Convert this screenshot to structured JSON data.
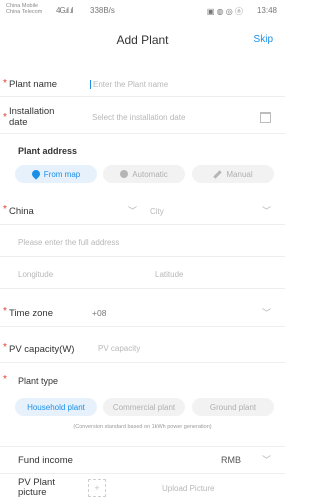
{
  "status_bar": {
    "carrier_line1": "China Mobile",
    "carrier_line2": "China Telecom",
    "signal": "4G",
    "speed": "338B/s",
    "icons": "▣ ◍ ◎ ⓝ",
    "time": "13:48"
  },
  "header": {
    "title": "Add Plant",
    "skip_label": "Skip"
  },
  "form": {
    "plant_name": {
      "label": "Plant name",
      "placeholder": "Enter the Plant name"
    },
    "installation_date": {
      "label": "Installation date",
      "placeholder": "Select the installation date"
    },
    "plant_address": {
      "label": "Plant address",
      "modes": [
        "From map",
        "Automatic",
        "Manual"
      ]
    },
    "country": {
      "label": "China",
      "region_placeholder": "City"
    },
    "full_address_placeholder": "Please enter the full address",
    "longitude_placeholder": "Longitude",
    "latitude_placeholder": "Latitude",
    "time_zone": {
      "label": "Time zone",
      "value": "+08"
    },
    "pv_capacity": {
      "label": "PV capacity(W)",
      "placeholder": "PV capacity"
    },
    "plant_type": {
      "label": "Plant type",
      "options": [
        "Household plant",
        "Commercial plant",
        "Ground plant"
      ],
      "note": "(Conversion standard based on 1kWh power generation)"
    },
    "fund_income": {
      "label": "Fund income",
      "currency": "RMB"
    },
    "pv_picture": {
      "label": "PV Plant picture",
      "upload_label": "Upload Picture"
    }
  },
  "colors": {
    "accent": "#1a8fe8",
    "required": "#e53935"
  }
}
